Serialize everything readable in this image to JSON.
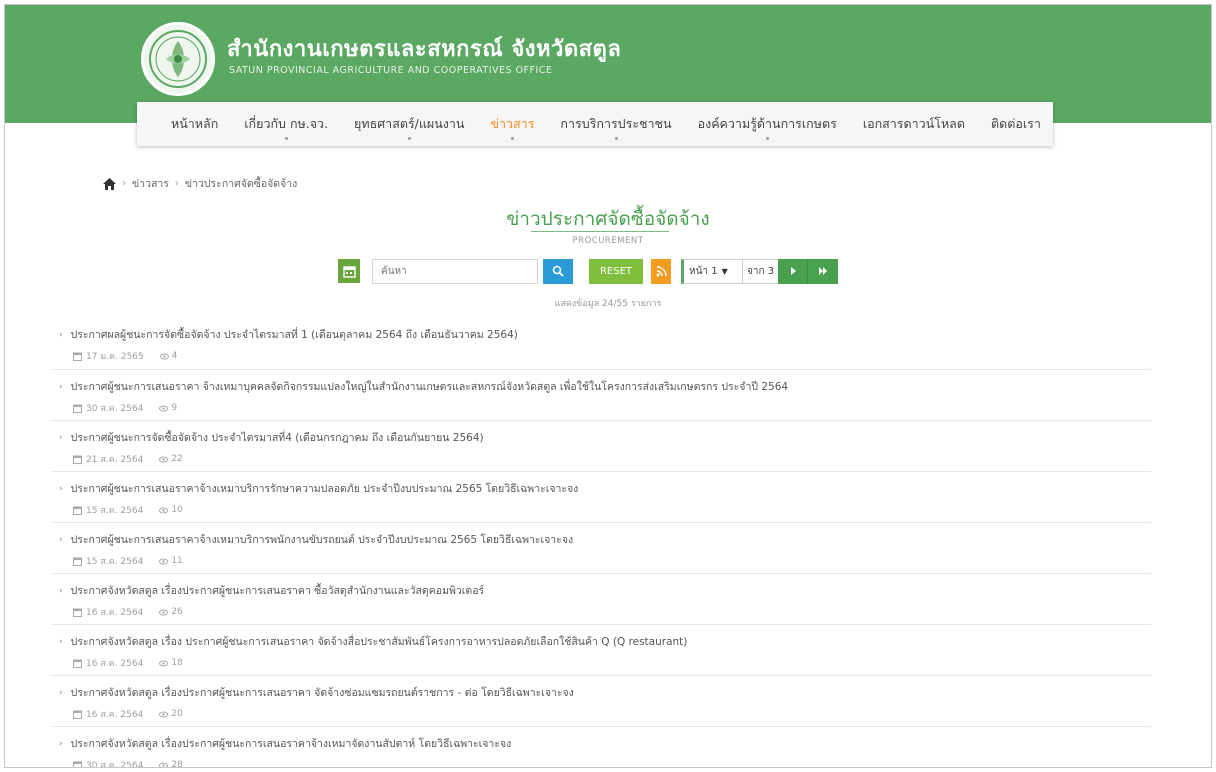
{
  "header": {
    "site_title": "สำนักงานเกษตรและสหกรณ์ จังหวัดสตูล",
    "site_subtitle": "SATUN PROVINCIAL AGRICULTURE AND COOPERATIVES OFFICE"
  },
  "nav": {
    "items": [
      {
        "label": "หน้าหลัก"
      },
      {
        "label": "เกี่ยวกับ กษ.จว."
      },
      {
        "label": "ยุทธศาสตร์/แผนงาน"
      },
      {
        "label": "ข่าวสาร"
      },
      {
        "label": "การบริการประชาชน"
      },
      {
        "label": "องค์ความรู้ด้านการเกษตร"
      },
      {
        "label": "เอกสารดาวน์โหลด"
      },
      {
        "label": "ติดต่อเรา"
      }
    ],
    "active_index": 3
  },
  "breadcrumb": {
    "items": [
      "ข่าวสาร",
      "ข่าวประกาศจัดซื้อจัดจ้าง"
    ]
  },
  "page": {
    "title": "ข่าวประกาศจัดซื้อจัดจ้าง",
    "subtitle": "PROCUREMENT"
  },
  "toolbar": {
    "search_placeholder": "ค้นหา",
    "reset_label": "RESET",
    "page_select": "หน้า 1",
    "total_pages": "จาก 3"
  },
  "total_records": "แสดงข้อมูล 24/55 รายการ",
  "items": [
    {
      "title": "ประกาศผลผู้ชนะการจัดซื้อจัดจ้าง ประจำไตรมาสที่ 1 (เดือนตุลาคม 2564 ถึง เดือนธันวาคม 2564)",
      "date": "17 ม.ค. 2565",
      "views": "4"
    },
    {
      "title": "ประกาศผู้ชนะการเสนอราคา จ้างเหมาบุคคลจัดกิจกรรมแปลงใหญ่ในสำนักงานเกษตรและสหกรณ์จังหวัดสตูล เพื่อใช้ในโครงการส่งเสริมเกษตรกร ประจำปี 2564",
      "date": "30 ส.ค. 2564",
      "views": "9"
    },
    {
      "title": "ประกาศผู้ชนะการจัดซื้อจัดจ้าง ประจำไตรมาสที่4 (เดือนกรกฎาคม ถึง เดือนกันยายน 2564)",
      "date": "21 ส.ค. 2564",
      "views": "22"
    },
    {
      "title": "ประกาศผู้ชนะการเสนอราคาจ้างเหมาบริการรักษาความปลอดภัย ประจำปีงบประมาณ 2565 โดยวิธีเฉพาะเจาะจง",
      "date": "15 ส.ค. 2564",
      "views": "10"
    },
    {
      "title": "ประกาศผู้ชนะการเสนอราคาจ้างเหมาบริการพนักงานขับรถยนต์ ประจำปีงบประมาณ 2565 โดยวิธีเฉพาะเจาะจง",
      "date": "15 ส.ค. 2564",
      "views": "11"
    },
    {
      "title": "ประกาศจังหวัดสตูล เรื่องประกาศผู้ชนะการเสนอราคา ซื้อวัสดุสำนักงานและวัสดุคอมพิวเตอร์",
      "date": "16 ส.ค. 2564",
      "views": "26"
    },
    {
      "title": "ประกาศจังหวัดสตูล เรื่อง ประกาศผู้ชนะการเสนอราคา จัดจ้างสื่อประชาสัมพันธ์โครงการอาหารปลอดภัยเลือกใช้สินค้า Q (Q restaurant)",
      "date": "16 ส.ค. 2564",
      "views": "18"
    },
    {
      "title": "ประกาศจังหวัดสตูล เรื่องประกาศผู้ชนะการเสนอราคา จัดจ้างซ่อมแซมรถยนต์ราชการ - ต่อ โดยวิธีเฉพาะเจาะจง",
      "date": "16 ส.ค. 2564",
      "views": "20"
    },
    {
      "title": "ประกาศจังหวัดสตูล เรื่องประกาศผู้ชนะการเสนอราคาจ้างเหมาจัดงานสัปดาห์ โดยวิธีเฉพาะเจาะจง",
      "date": "30 ส.ค. 2564",
      "views": "28"
    }
  ]
}
